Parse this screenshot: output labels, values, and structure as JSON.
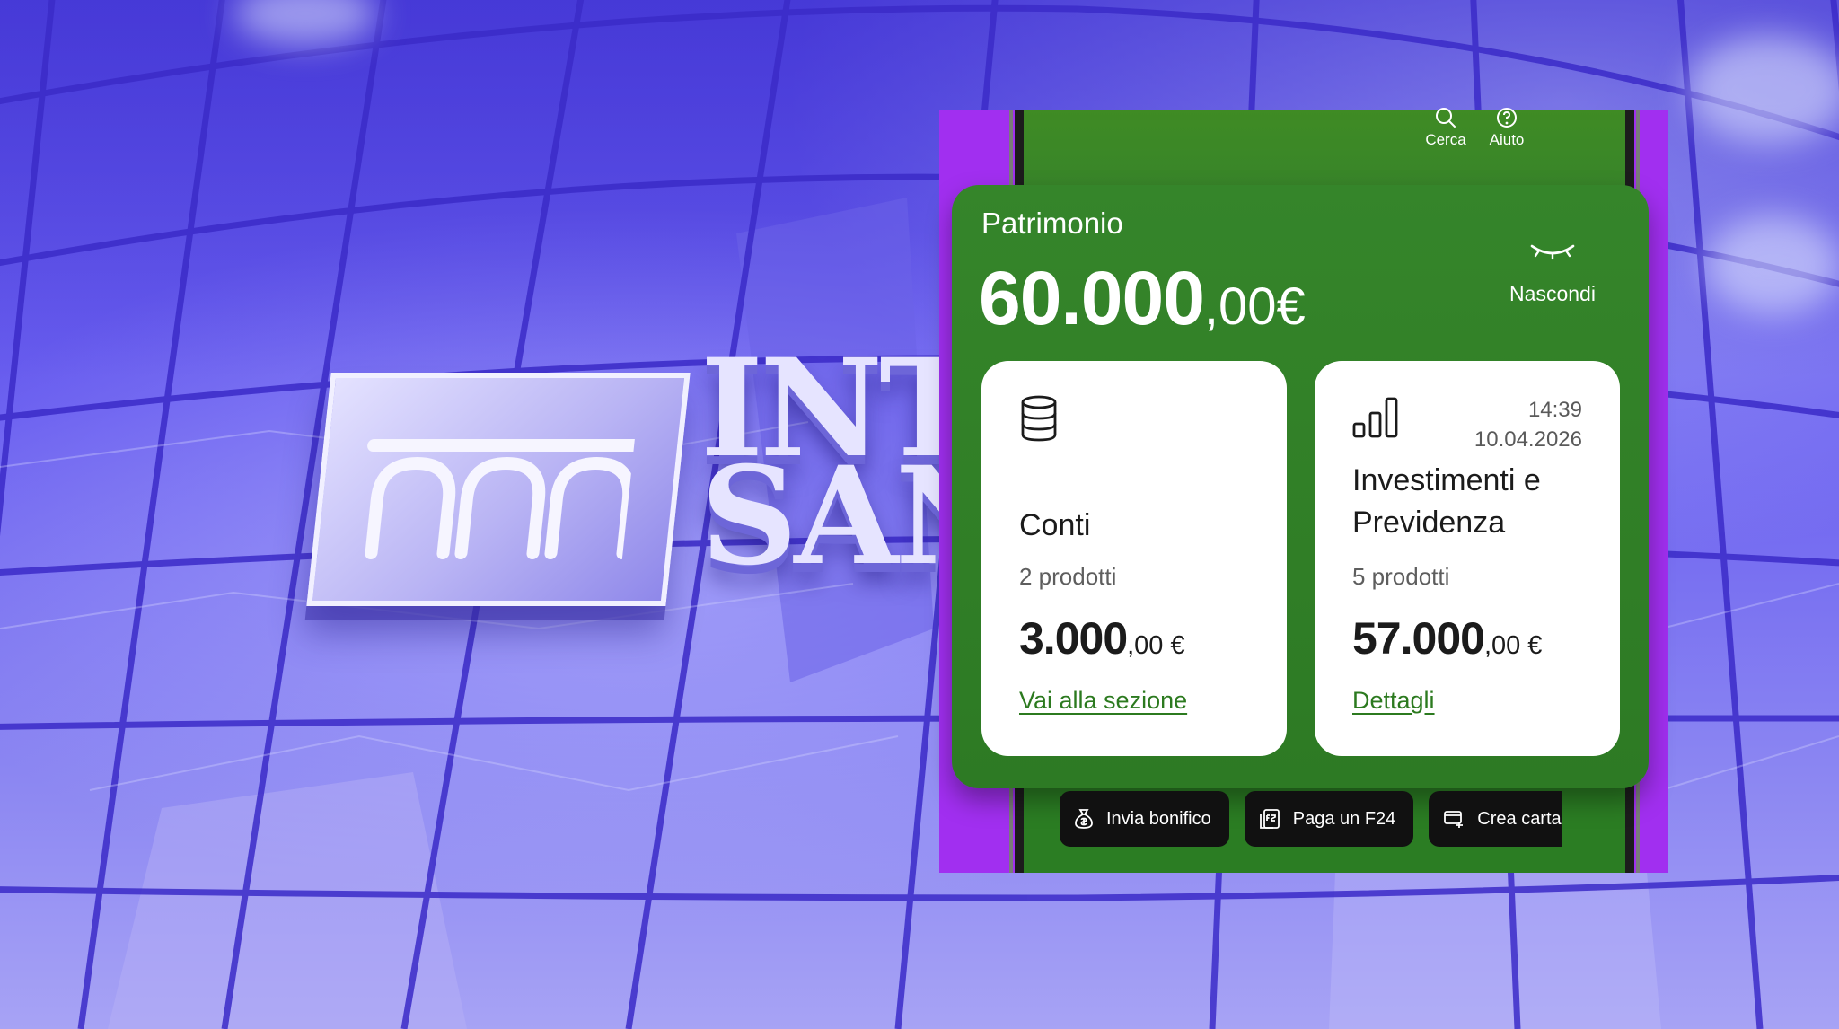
{
  "background": {
    "bank_sign_lines": [
      "INT",
      "SAN"
    ]
  },
  "top_bar": {
    "search_label": "Cerca",
    "search_icon": "search-icon",
    "help_label": "Aiuto",
    "help_icon": "help-circle-icon"
  },
  "summary": {
    "title": "Patrimonio",
    "total_integer": "60.000",
    "total_decimal": ",00€",
    "hide_label": "Nascondi",
    "hide_icon": "closed-eye-icon"
  },
  "cards": {
    "conti": {
      "icon": "coins-stack-icon",
      "title": "Conti",
      "subtitle": "2 prodotti",
      "amount_integer": "3.000",
      "amount_decimal": ",00 €",
      "link_label": "Vai alla sezione"
    },
    "investimenti": {
      "icon": "bar-chart-icon",
      "title_line1": "Investimenti e",
      "title_line2": "Previdenza",
      "subtitle": "5 prodotti",
      "amount_integer": "57.000",
      "amount_decimal": ",00 €",
      "time": "14:39",
      "date": "10.04.2026",
      "link_label": "Dettagli"
    }
  },
  "quick_actions": [
    {
      "label": "Invia bonifico",
      "icon": "money-bag-icon"
    },
    {
      "label": "Paga un F24",
      "icon": "f24-form-icon"
    },
    {
      "label": "Crea carta",
      "icon": "card-icon"
    }
  ],
  "colors": {
    "brand_green": "#2d7a24",
    "link_green": "#2c7a1f",
    "panel_purple": "#a12ff0",
    "background_blue": "#5346e0"
  }
}
